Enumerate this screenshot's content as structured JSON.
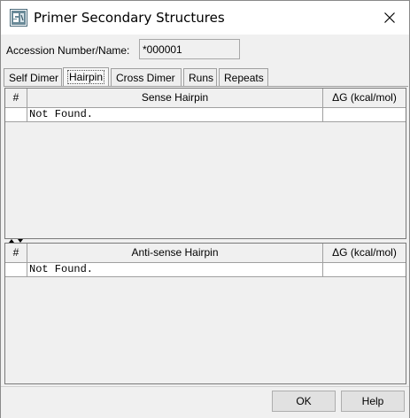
{
  "window": {
    "title": "Primer Secondary Structures"
  },
  "accession": {
    "label": "Accession Number/Name:",
    "value": "*000001"
  },
  "tabs": [
    {
      "label": "Self Dimer"
    },
    {
      "label": "Hairpin"
    },
    {
      "label": "Cross Dimer"
    },
    {
      "label": "Runs"
    },
    {
      "label": "Repeats"
    }
  ],
  "active_tab": "Hairpin",
  "sense_table": {
    "columns": [
      "#",
      "Sense Hairpin",
      "ΔG (kcal/mol)"
    ],
    "rows": [
      {
        "num": "",
        "structure": "Not Found.",
        "dg": ""
      }
    ]
  },
  "antisense_table": {
    "columns": [
      "#",
      "Anti-sense Hairpin",
      "ΔG (kcal/mol)"
    ],
    "rows": [
      {
        "num": "",
        "structure": "Not Found.",
        "dg": ""
      }
    ]
  },
  "buttons": {
    "ok": "OK",
    "help": "Help"
  },
  "icons": {
    "app": "primer-structures-app-icon",
    "close": "close-icon",
    "splitter": "splitter-arrows-icon"
  }
}
